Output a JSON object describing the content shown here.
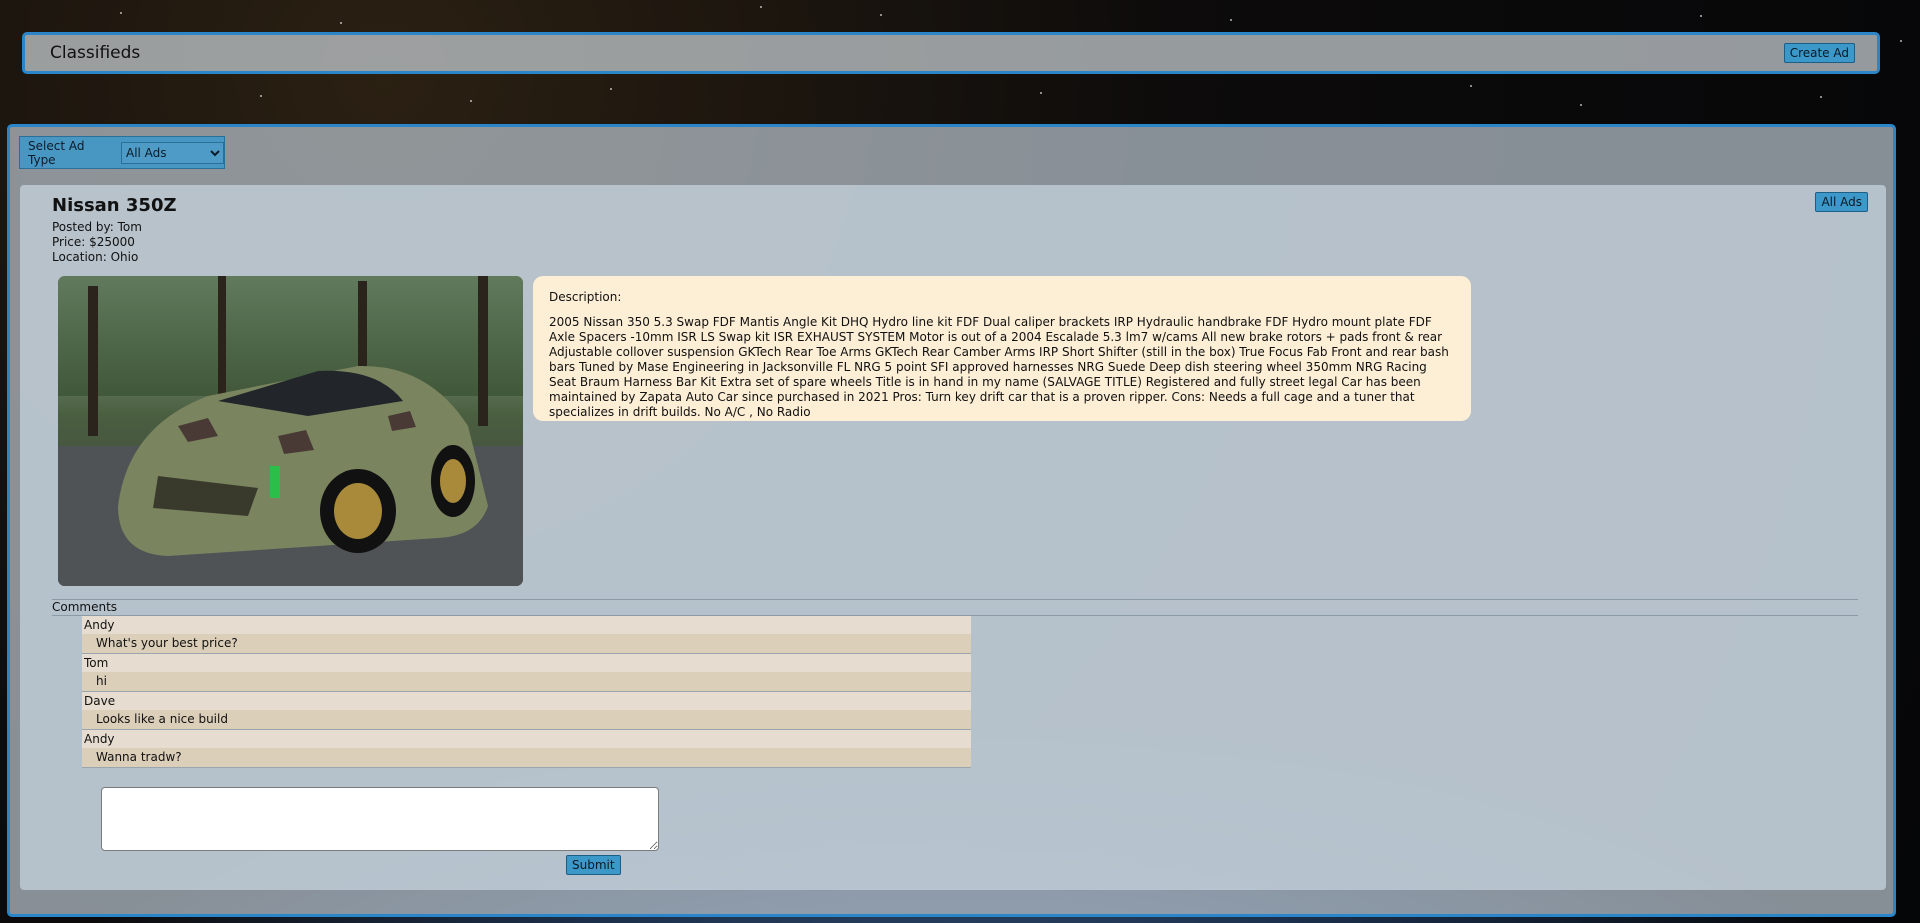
{
  "header": {
    "title": "Classifieds",
    "create_label": "Create Ad"
  },
  "filter": {
    "label": "Select Ad Type",
    "selected": "All Ads"
  },
  "ad": {
    "title": "Nissan 350Z",
    "posted_by": "Posted by: Tom",
    "price": "Price: $25000",
    "location": "Location: Ohio",
    "all_ads_label": "All Ads",
    "description_label": "Description:",
    "description": "2005 Nissan 350 5.3 Swap FDF Mantis Angle Kit DHQ Hydro line kit FDF Dual caliper brackets IRP Hydraulic handbrake FDF Hydro mount plate FDF Axle Spacers -10mm ISR LS Swap kit ISR EXHAUST SYSTEM Motor is out of a 2004 Escalade 5.3 lm7 w/cams All new brake rotors + pads front & rear Adjustable collover suspension GKTech Rear Toe Arms GKTech Rear Camber Arms IRP Short Shifter (still in the box) True Focus Fab Front and rear bash bars Tuned by Mase Engineering in Jacksonville FL NRG 5 point SFI approved harnesses NRG Suede Deep dish steering wheel 350mm NRG Racing Seat Braum Harness Bar Kit Extra set of spare wheels Title is in hand in my name (SALVAGE TITLE) Registered and fully street legal Car has been maintained by Zapata Auto Car since purchased in 2021 Pros: Turn key drift car that is a proven ripper. Cons: Needs a full cage and a tuner that specializes in drift builds. No A/C , No Radio"
  },
  "comments": {
    "label": "Comments",
    "items": [
      {
        "user": "Andy",
        "text": "What's your best price?"
      },
      {
        "user": "Tom",
        "text": "hi"
      },
      {
        "user": "Dave",
        "text": "Looks like a nice build"
      },
      {
        "user": "Andy",
        "text": "Wanna tradw?"
      }
    ],
    "reply_value": "",
    "submit_label": "Submit"
  }
}
